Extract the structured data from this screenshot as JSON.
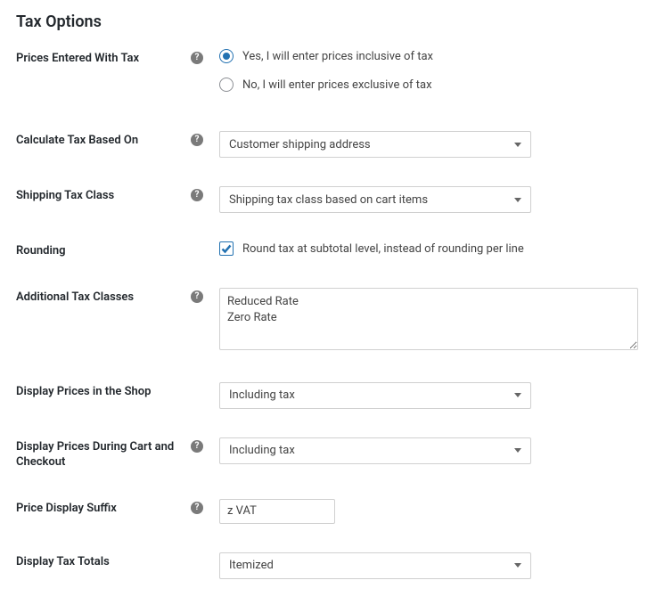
{
  "heading": "Tax Options",
  "fields": {
    "prices_entered": {
      "label": "Prices Entered With Tax",
      "opt_yes": "Yes, I will enter prices inclusive of tax",
      "opt_no": "No, I will enter prices exclusive of tax",
      "selected": "yes"
    },
    "calc_tax": {
      "label": "Calculate Tax Based On",
      "value": "Customer shipping address"
    },
    "ship_class": {
      "label": "Shipping Tax Class",
      "value": "Shipping tax class based on cart items"
    },
    "rounding": {
      "label": "Rounding",
      "text": "Round tax at subtotal level, instead of rounding per line",
      "checked": true
    },
    "add_classes": {
      "label": "Additional Tax Classes",
      "value": "Reduced Rate\nZero Rate"
    },
    "disp_shop": {
      "label": "Display Prices in the Shop",
      "value": "Including tax"
    },
    "disp_cart": {
      "label": "Display Prices During Cart and Checkout",
      "value": "Including tax"
    },
    "suffix": {
      "label": "Price Display Suffix",
      "value": "z VAT"
    },
    "totals": {
      "label": "Display Tax Totals",
      "value": "Itemized"
    }
  }
}
